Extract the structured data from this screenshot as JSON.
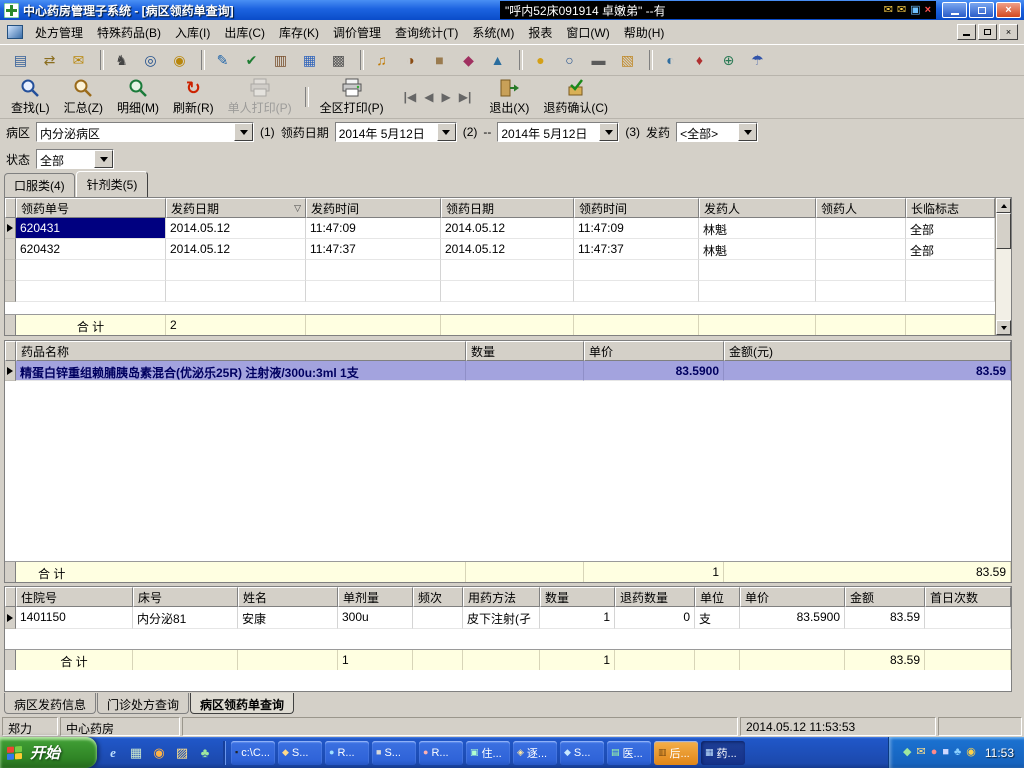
{
  "titlebar": {
    "title": "中心药房管理子系统 - [病区领药单查询]",
    "message": "\"呼内52床091914 卓嫩弟\" --有"
  },
  "message_icons": [
    {
      "name": "mail-alert-icon-1",
      "glyph": "✉"
    },
    {
      "name": "mail-alert-icon-2",
      "glyph": "✉"
    },
    {
      "name": "info-alert-icon",
      "glyph": "▣"
    },
    {
      "name": "error-alert-icon",
      "glyph": "×"
    }
  ],
  "window_controls": {
    "close_glyph": "×"
  },
  "menubar": {
    "items": [
      "处方管理",
      "特殊药品(B)",
      "入库(I)",
      "出库(C)",
      "库存(K)",
      "调价管理",
      "查询统计(T)",
      "系统(M)",
      "报表",
      "窗口(W)",
      "帮助(H)"
    ]
  },
  "toolbar1": {
    "icons": [
      {
        "name": "print-preview-icon",
        "glyph": "▤"
      },
      {
        "name": "scales-icon",
        "glyph": "⇄"
      },
      {
        "name": "mail-check-icon",
        "glyph": "✉"
      },
      {
        "name": "transport-icon",
        "glyph": "♞"
      },
      {
        "name": "binoculars-icon",
        "glyph": "◎"
      },
      {
        "name": "money-bag-icon",
        "glyph": "◉"
      },
      {
        "name": "edit-doc-icon",
        "glyph": "✎"
      },
      {
        "name": "approve-icon",
        "glyph": "✔"
      },
      {
        "name": "ledger-icon",
        "glyph": "▥"
      },
      {
        "name": "copy-doc-icon",
        "glyph": "▦"
      },
      {
        "name": "table-icon",
        "glyph": "▩"
      },
      {
        "name": "bell-icon",
        "glyph": "♫"
      },
      {
        "name": "clock-icon",
        "glyph": "◑"
      },
      {
        "name": "package-icon",
        "glyph": "■"
      },
      {
        "name": "gift-icon",
        "glyph": "◆"
      },
      {
        "name": "chart-icon",
        "glyph": "▲"
      },
      {
        "name": "coins-icon",
        "glyph": "●"
      },
      {
        "name": "search-icon",
        "glyph": "○"
      },
      {
        "name": "printer-icon",
        "glyph": "▬"
      },
      {
        "name": "folder-icon",
        "glyph": "▧"
      },
      {
        "name": "network-icon",
        "glyph": "◐"
      },
      {
        "name": "cards-icon",
        "glyph": "♦"
      },
      {
        "name": "attach-icon",
        "glyph": "⊕"
      },
      {
        "name": "umbrella-icon",
        "glyph": "☂"
      }
    ]
  },
  "toolbar2": {
    "find": "查找(L)",
    "summary": "汇总(Z)",
    "detail": "明细(M)",
    "refresh": "刷新(R)",
    "refresh_glyph": "↻",
    "print_single": "单人打印(P)",
    "print_all": "全区打印(P)",
    "nav": [
      "|◀",
      "◀",
      "▶",
      "▶|"
    ],
    "exit": "退出(X)",
    "confirm": "退药确认(C)"
  },
  "filters": {
    "ward_label": "病区",
    "ward_value": "内分泌病区",
    "n1": "(1)",
    "date_label": "领药日期",
    "date_from": "2014年  5月12日",
    "n2": "(2)",
    "range_sep": "--",
    "date_to": "2014年  5月12日",
    "n3": "(3)",
    "dispense_label": "发药",
    "dispense_value": "<全部>",
    "status_label": "状态",
    "status_value": "全部"
  },
  "tabs": {
    "oral": "口服类(4)",
    "injection": "针剂类(5)"
  },
  "grid1": {
    "headers": [
      "领药单号",
      "发药日期",
      "发药时间",
      "领药日期",
      "领药时间",
      "发药人",
      "领药人",
      "长临标志"
    ],
    "sort_glyph": "▽",
    "rows": [
      [
        "620431",
        "2014.05.12",
        "11:47:09",
        "2014.05.12",
        "11:47:09",
        "林魁",
        "",
        "全部"
      ],
      [
        "620432",
        "2014.05.12",
        "11:47:37",
        "2014.05.12",
        "11:47:37",
        "林魁",
        "",
        "全部"
      ]
    ],
    "total_label": "合  计",
    "total_value": "2"
  },
  "grid2": {
    "headers": [
      "药品名称",
      "数量",
      "单价",
      "金额(元)"
    ],
    "rows": [
      [
        "精蛋白锌重组赖脯胰岛素混合(优泌乐25R) 注射液/300u:3ml 1支",
        "",
        "83.5900",
        "83.59"
      ]
    ],
    "total_label": "合  计",
    "total_qty": "1",
    "total_amount": "83.59"
  },
  "grid3": {
    "headers": [
      "住院号",
      "床号",
      "姓名",
      "单剂量",
      "频次",
      "用药方法",
      "数量",
      "退药数量",
      "单位",
      "单价",
      "金额",
      "首日次数"
    ],
    "rows": [
      [
        "1401150",
        "内分泌81",
        "安康",
        "300u",
        "",
        "皮下注射(孑",
        "1",
        "0",
        "支",
        "83.5900",
        "83.59",
        ""
      ]
    ],
    "total_label": "合  计",
    "total_dose": "1",
    "total_qty": "1",
    "total_amount": "83.59"
  },
  "bottom_tabs": [
    "病区发药信息",
    "门诊处方查询",
    "病区领药单查询"
  ],
  "statusbar": {
    "user": "郑力",
    "department": "中心药房",
    "datetime": "2014.05.12 11:53:53"
  },
  "taskbar": {
    "start": "开始",
    "quicklaunch": [
      {
        "name": "ie-icon",
        "glyph": "e"
      },
      {
        "name": "desktop-icon",
        "glyph": "▦"
      },
      {
        "name": "media-player-icon",
        "glyph": "◉"
      },
      {
        "name": "folder-icon",
        "glyph": "▨"
      },
      {
        "name": "messenger-icon",
        "glyph": "♣"
      }
    ],
    "buttons": [
      {
        "name": "task-cmd",
        "icon": "▪",
        "label": "c:\\C..."
      },
      {
        "name": "task-s1",
        "icon": "◆",
        "label": "S..."
      },
      {
        "name": "task-r1",
        "icon": "●",
        "label": "R..."
      },
      {
        "name": "task-s2",
        "icon": "■",
        "label": "S..."
      },
      {
        "name": "task-r2",
        "icon": "●",
        "label": "R..."
      },
      {
        "name": "task-zhu",
        "icon": "▣",
        "label": "住..."
      },
      {
        "name": "task-zhu2",
        "icon": "◈",
        "label": "逐..."
      },
      {
        "name": "task-s3",
        "icon": "◆",
        "label": "S..."
      },
      {
        "name": "task-yi",
        "icon": "▤",
        "label": "医..."
      },
      {
        "name": "task-hou",
        "icon": "▥",
        "label": "后..."
      },
      {
        "name": "task-yao",
        "icon": "▦",
        "label": "药..."
      }
    ],
    "tray_icons": [
      {
        "name": "tray-shield-icon",
        "glyph": "◆"
      },
      {
        "name": "tray-mail-icon",
        "glyph": "✉"
      },
      {
        "name": "tray-av-icon",
        "glyph": "●"
      },
      {
        "name": "tray-volume-icon",
        "glyph": "■"
      },
      {
        "name": "tray-net-icon",
        "glyph": "♣"
      },
      {
        "name": "tray-update-icon",
        "glyph": "◉"
      }
    ],
    "time": "11:53"
  }
}
